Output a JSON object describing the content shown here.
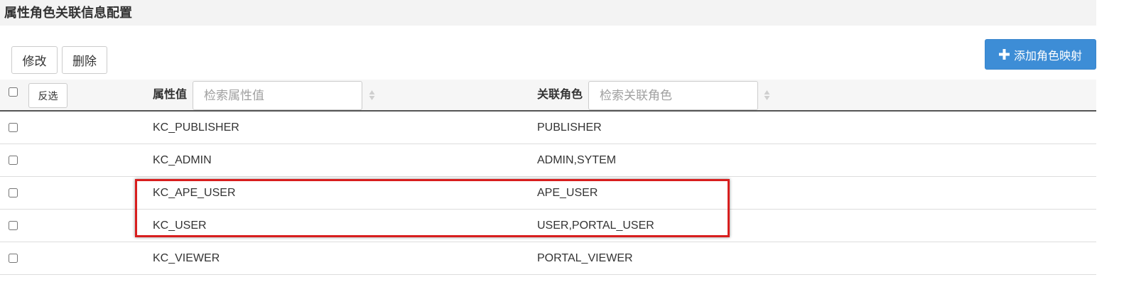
{
  "page": {
    "title": "属性角色关联信息配置"
  },
  "toolbar": {
    "edit_label": "修改",
    "delete_label": "删除",
    "add_label": "添加角色映射",
    "add_icon": "plus-icon"
  },
  "table": {
    "invert_selection_label": "反选",
    "columns": [
      {
        "label": "属性值",
        "search_placeholder": "检索属性值",
        "sort_icon": "sort-icon"
      },
      {
        "label": "关联角色",
        "search_placeholder": "检索关联角色",
        "sort_icon": "sort-icon"
      }
    ],
    "rows": [
      {
        "attribute_value": "KC_PUBLISHER",
        "roles": "PUBLISHER"
      },
      {
        "attribute_value": "KC_ADMIN",
        "roles": "ADMIN,SYTEM"
      },
      {
        "attribute_value": "KC_APE_USER",
        "roles": "APE_USER"
      },
      {
        "attribute_value": "KC_USER",
        "roles": "USER,PORTAL_USER"
      },
      {
        "attribute_value": "KC_VIEWER",
        "roles": "PORTAL_VIEWER"
      }
    ]
  },
  "colors": {
    "primary_button": "#3d8dd6",
    "highlight_annotation": "#d81e1e",
    "header_background": "#f6f6f6"
  }
}
